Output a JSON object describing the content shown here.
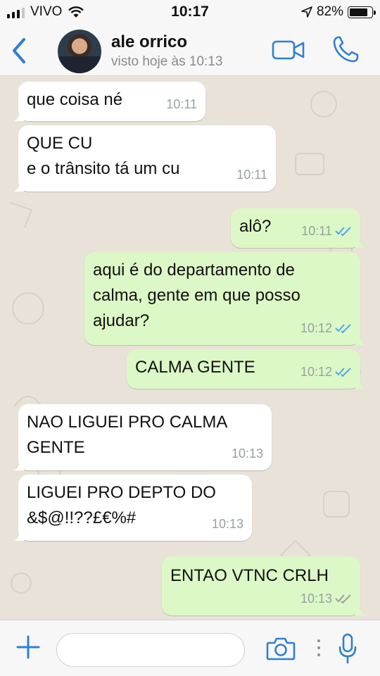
{
  "status_bar": {
    "carrier": "VIVO",
    "time": "10:17",
    "battery": "82%",
    "battery_level": 0.82,
    "icons": [
      "signal-icon",
      "wifi-icon",
      "location-arrow-icon",
      "battery-icon"
    ]
  },
  "header": {
    "contact_name": "ale orrico",
    "last_seen": "visto hoje às 10:13",
    "icons": [
      "back-chevron-icon",
      "avatar",
      "video-camera-icon",
      "phone-icon"
    ]
  },
  "messages": [
    {
      "direction": "in",
      "text": "que coisa né",
      "time": "10:11"
    },
    {
      "direction": "in",
      "text": "QUE CU\ne o trânsito tá um cu",
      "time": "10:11"
    },
    {
      "direction": "out",
      "text": "alô?",
      "time": "10:11",
      "read": true
    },
    {
      "direction": "out",
      "text": "aqui é do departamento de\ncalma, gente em que posso\najudar?",
      "time": "10:12",
      "read": true
    },
    {
      "direction": "out",
      "text": "CALMA GENTE",
      "time": "10:12",
      "read": true
    },
    {
      "direction": "in",
      "text": "NAO LIGUEI PRO CALMA\nGENTE",
      "time": "10:13"
    },
    {
      "direction": "in",
      "text": "LIGUEI PRO DEPTO DO\n&$@!!??£€%#",
      "time": "10:13"
    },
    {
      "direction": "out",
      "text": "ENTAO VTNC CRLH",
      "time": "10:13",
      "read": false
    }
  ],
  "input_bar": {
    "placeholder": "",
    "icons": [
      "plus-icon",
      "camera-icon",
      "more-dots-icon",
      "microphone-icon"
    ]
  },
  "colors": {
    "accent": "#2f80d1",
    "outgoing_bubble": "#dcf8c6",
    "incoming_bubble": "#ffffff",
    "chat_background": "#e9e2d8",
    "read_tick": "#4fa7e8",
    "unread_tick": "#9aa0a0"
  }
}
